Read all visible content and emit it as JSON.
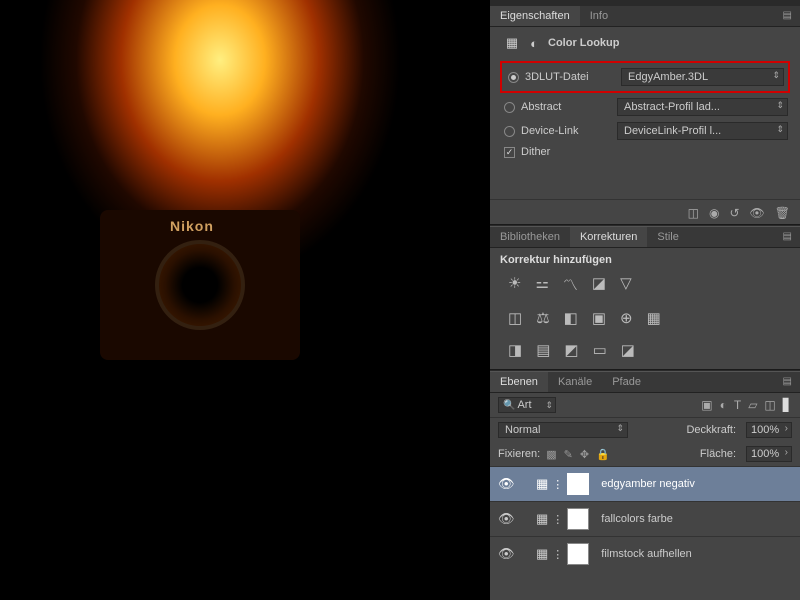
{
  "canvas": {
    "brand": "Nikon"
  },
  "panels": {
    "properties": {
      "tabs": {
        "eigenschaften": "Eigenschaften",
        "info": "Info"
      },
      "title": "Color Lookup",
      "rows": {
        "lut": {
          "label": "3DLUT-Datei",
          "value": "EdgyAmber.3DL"
        },
        "abstract": {
          "label": "Abstract",
          "value": "Abstract-Profil lad..."
        },
        "devicelink": {
          "label": "Device-Link",
          "value": "DeviceLink-Profil l..."
        },
        "dither": {
          "label": "Dither"
        }
      }
    },
    "libraries": {
      "tabs": {
        "bibliotheken": "Bibliotheken",
        "korrekturen": "Korrekturen",
        "stile": "Stile"
      },
      "subhead": "Korrektur hinzufügen"
    },
    "layers": {
      "tabs": {
        "ebenen": "Ebenen",
        "kanaele": "Kanäle",
        "pfade": "Pfade"
      },
      "search": "Art",
      "blend": {
        "mode": "Normal",
        "opacity_label": "Deckkraft:",
        "opacity": "100%"
      },
      "lock": {
        "label": "Fixieren:",
        "fill_label": "Fläche:",
        "fill": "100%"
      },
      "items": [
        {
          "name": "edgyamber negativ"
        },
        {
          "name": "fallcolors farbe"
        },
        {
          "name": "filmstock aufhellen"
        }
      ]
    }
  }
}
